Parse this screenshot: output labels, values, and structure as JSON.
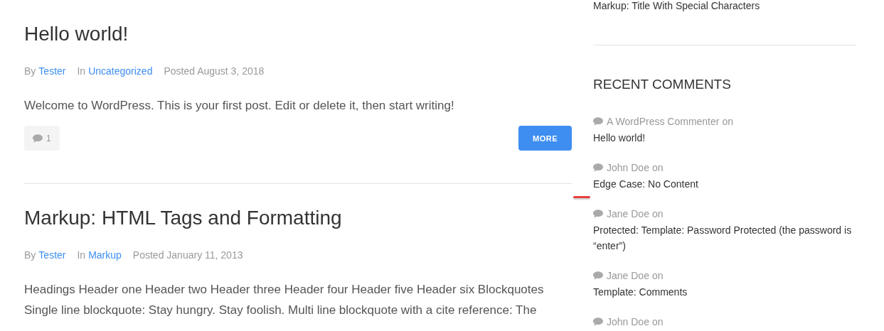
{
  "posts": [
    {
      "title": "Hello world!",
      "by_label": "By",
      "author": "Tester",
      "in_label": "In",
      "category": "Uncategorized",
      "posted": "Posted August 3, 2018",
      "excerpt": "Welcome to WordPress. This is your first post. Edit or delete it, then start writing!",
      "comments": "1",
      "more": "MORE"
    },
    {
      "title": "Markup: HTML Tags and Formatting",
      "by_label": "By",
      "author": "Tester",
      "in_label": "In",
      "category": "Markup",
      "posted": "Posted January 11, 2013",
      "excerpt": "Headings Header one Header two Header three Header four Header five Header six Blockquotes Single line blockquote: Stay hungry. Stay foolish. Multi line blockquote with a cite reference: The"
    }
  ],
  "sidebar": {
    "top_link": "Markup: Title With Special Characters",
    "recent_comments": {
      "title": "RECENT COMMENTS",
      "items": [
        {
          "author": "A WordPress Commenter",
          "on": "on",
          "post": "Hello world!"
        },
        {
          "author": "John Doe",
          "on": "on",
          "post": "Edge Case: No Content"
        },
        {
          "author": "Jane Doe",
          "on": "on",
          "post": "Protected: Template: Password Protected (the password is “enter”)"
        },
        {
          "author": "Jane Doe",
          "on": "on",
          "post": "Template: Comments"
        },
        {
          "author": "John Doe",
          "on": "on"
        }
      ]
    }
  }
}
